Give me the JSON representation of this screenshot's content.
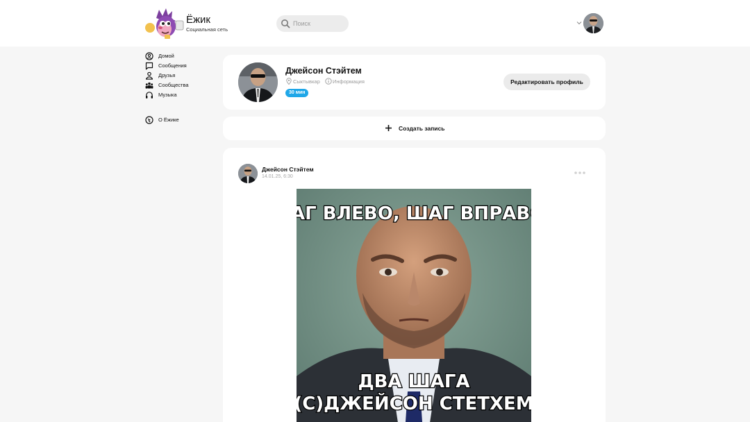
{
  "header": {
    "brand_title": "Ёжик",
    "brand_subtitle": "Социальная сеть",
    "search_placeholder": "Поиск"
  },
  "sidebar": {
    "items": [
      {
        "label": "Домой",
        "icon": "user-circle-icon"
      },
      {
        "label": "Сообщения",
        "icon": "chat-icon"
      },
      {
        "label": "Друзья",
        "icon": "friends-icon"
      },
      {
        "label": "Сообщества",
        "icon": "communities-icon"
      },
      {
        "label": "Музыка",
        "icon": "headphones-icon"
      }
    ],
    "about": {
      "label": "О Ёжике",
      "icon": "info-compass-icon"
    }
  },
  "profile": {
    "name": "Джейсон Стэйтем",
    "location": "Сыктывкар",
    "info_label": "Информация",
    "status_badge": "30 мин",
    "edit_button": "Редактировать профиль"
  },
  "create_post": {
    "label": "Создать запись"
  },
  "post": {
    "author": "Джейсон Стэйтем",
    "date": "14.01.25, 6:30",
    "image": {
      "top_caption": "ШАГ ВЛЕВО, ШАГ ВПРАВО -",
      "bottom_caption_line1": "ДВА ШАГА",
      "bottom_caption_line2": "(С)ДЖЕЙСОН СТЕТХЕМ"
    }
  },
  "colors": {
    "background": "#f6f6f6",
    "card": "#ffffff",
    "accent": "#1fa7e8",
    "button": "#ebebeb"
  }
}
